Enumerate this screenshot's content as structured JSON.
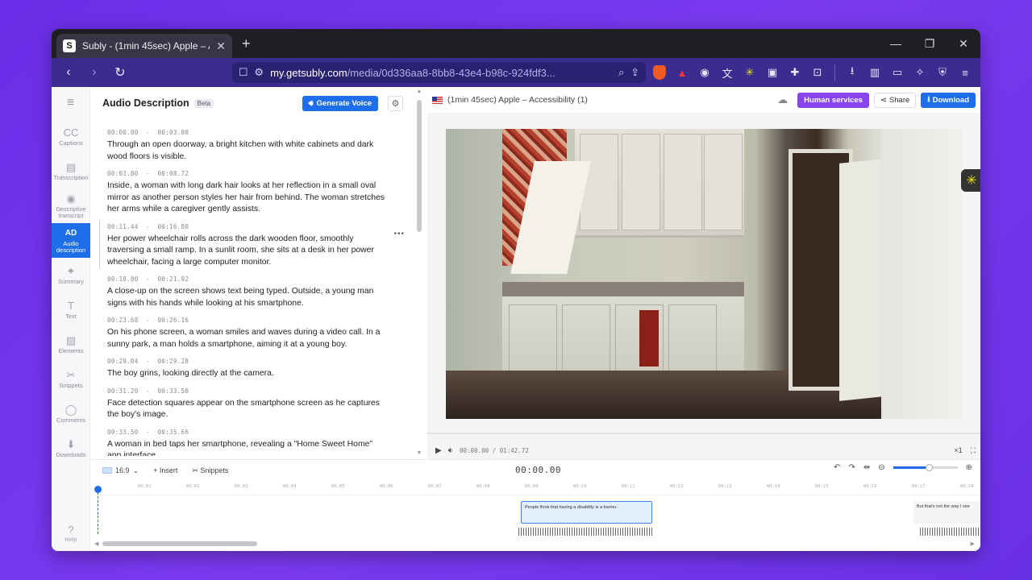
{
  "browser": {
    "tab_title": "Subly - (1min 45sec) Apple – Acc",
    "tab_favicon": "S",
    "url_host": "my.getsubly.com",
    "url_path": "/media/0d336aa8-8bb8-43e4-b98c-924fdf3..."
  },
  "rail": {
    "items": [
      {
        "label": "Captions",
        "icon": "CC"
      },
      {
        "label": "Transcription",
        "icon": "▤"
      },
      {
        "label": "Descriptive transcript",
        "icon": "◉"
      },
      {
        "label": "Audio description",
        "icon": "AD"
      },
      {
        "label": "Summary",
        "icon": "✦"
      },
      {
        "label": "Text",
        "icon": "T"
      },
      {
        "label": "Elements",
        "icon": "▨"
      },
      {
        "label": "Snippets",
        "icon": "✂"
      },
      {
        "label": "Comments",
        "icon": "◯"
      },
      {
        "label": "Downloads",
        "icon": "⬇"
      }
    ],
    "help_label": "Help"
  },
  "panel": {
    "title": "Audio Description",
    "badge": "Beta",
    "generate_label": "Generate Voice",
    "segments": [
      {
        "start": "00:00.00",
        "end": "00:03.80",
        "text": "Through an open doorway, a bright kitchen with white cabinets and dark wood floors is visible."
      },
      {
        "start": "00:03.80",
        "end": "00:08.72",
        "text": "Inside, a woman with long dark hair looks at her reflection in a small oval mirror as another person styles her hair from behind. The woman stretches her arms while a caregiver gently assists."
      },
      {
        "start": "00:11.44",
        "end": "00:16.80",
        "text": "Her power wheelchair rolls across the dark wooden floor, smoothly traversing a small ramp. In a sunlit room, she sits at a desk in her power wheelchair, facing a large computer monitor."
      },
      {
        "start": "00:18.80",
        "end": "00:21.92",
        "text": "A close-up on the screen shows text being typed. Outside, a young man signs with his hands while looking at his smartphone."
      },
      {
        "start": "00:23.68",
        "end": "00:26.16",
        "text": "On his phone screen, a woman smiles and waves during a video call. In a sunny park, a man holds a smartphone, aiming it at a young boy."
      },
      {
        "start": "00:29.04",
        "end": "00:29.28",
        "text": "The boy grins, looking directly at the camera."
      },
      {
        "start": "00:31.20",
        "end": "00:33.50",
        "text": "Face detection squares appear on the smartphone screen as he captures the boy's image."
      },
      {
        "start": "00:33.50",
        "end": "00:35.66",
        "text": "A woman in bed taps her smartphone, revealing a \"Home Sweet Home\" app interface."
      }
    ]
  },
  "video": {
    "title": "(1min 45sec) Apple – Accessibility (1)",
    "human_services_label": "Human services",
    "share_label": "Share",
    "download_label": "Download",
    "current_time": "00:00.00",
    "duration": "01:42.72",
    "speed": "×1",
    "progress": 0
  },
  "timeline": {
    "ratio": "16:9",
    "insert_label": "+ Insert",
    "snippets_label": "Snippets",
    "timecode": "00:00.00",
    "ticks": [
      "00:01",
      "00:02",
      "00:03",
      "00:04",
      "00:05",
      "00:06",
      "00:07",
      "00:08",
      "00:09",
      "00:10",
      "00:11",
      "00:12",
      "00:13",
      "00:14",
      "00:15",
      "00:16",
      "00:17",
      "00:18"
    ],
    "clip1_text": "People think that having a disability is a barrier.",
    "clip2_text": "But that's not the way I see",
    "zoom_level": 0.55
  },
  "colors": {
    "accent": "#1d6ee8",
    "human_services": "#8b45f0",
    "address_bar": "#3b2d8f"
  }
}
